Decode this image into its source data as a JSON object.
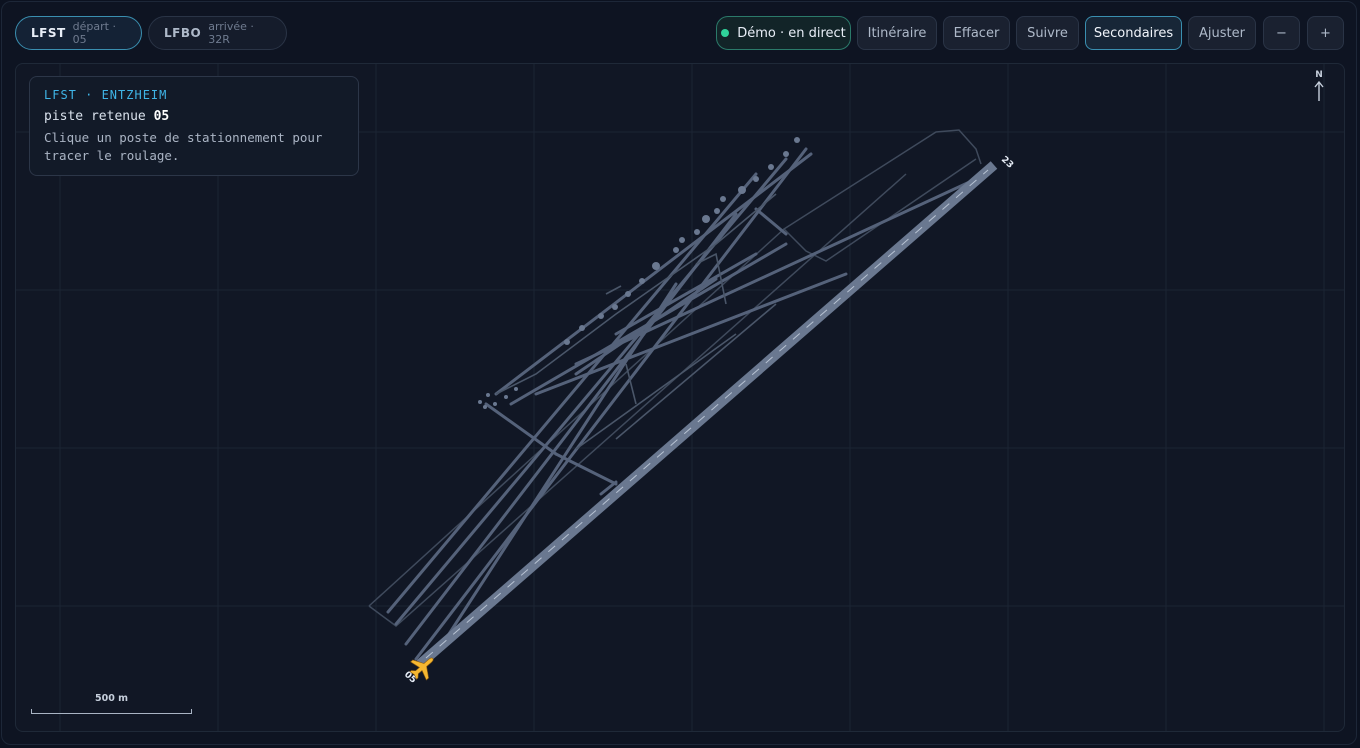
{
  "airports": [
    {
      "code": "LFST",
      "sub": "départ · 05"
    },
    {
      "code": "LFBO",
      "sub": "arrivée · 32R"
    }
  ],
  "toolbar": {
    "live": "Démo · en direct",
    "itinerary": "Itinéraire",
    "clear": "Effacer",
    "follow": "Suivre",
    "secondary": "Secondaires",
    "fit": "Ajuster",
    "zoom_out": "−",
    "zoom_in": "+"
  },
  "info": {
    "title": "LFST · ENTZHEIM",
    "runway_prefix": "piste retenue",
    "runway": "05",
    "hint": "Clique un poste de stationnement pour tracer le roulage."
  },
  "map": {
    "north": "N",
    "scale": "500 m",
    "runway_end_a": "05",
    "runway_end_b": "23"
  },
  "colors": {
    "accent": "#3fb4e6",
    "live": "#2fd39a",
    "taxiway": "#5d6a80",
    "runway": "#66758c",
    "aircraft": "#f5b731"
  }
}
